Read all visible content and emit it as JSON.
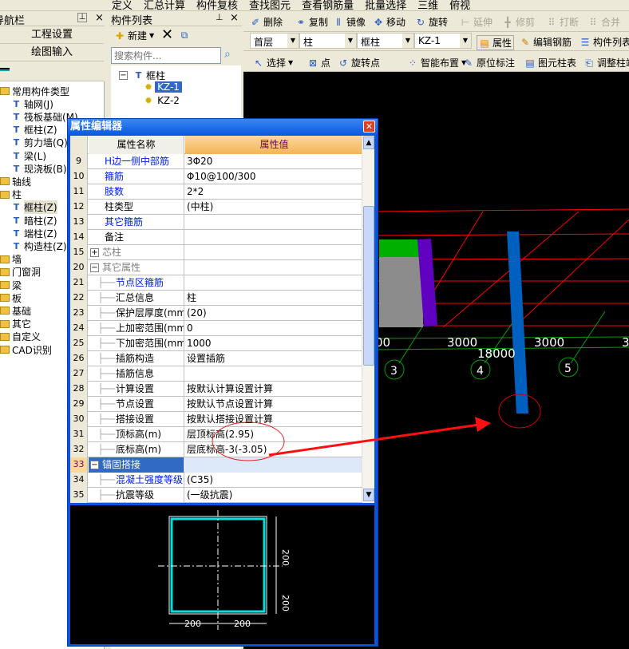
{
  "top_toolbar": {
    "items": [
      "定义",
      "汇总计算",
      "构件复核",
      "查找图元",
      "查看钢筋量",
      "批量选择",
      "三维",
      "俯视"
    ]
  },
  "nav_panel": {
    "title": "导航栏",
    "buttons": [
      "工程设置",
      "绘图输入"
    ],
    "tree": [
      {
        "label": "常用构件类型",
        "type": "folder-open",
        "level": 0
      },
      {
        "label": "轴网(J)",
        "icon": "grid-icon",
        "level": 1
      },
      {
        "label": "筏板基础(M)",
        "icon": "raft-icon",
        "level": 1
      },
      {
        "label": "框柱(Z)",
        "icon": "column-icon",
        "level": 1
      },
      {
        "label": "剪力墙(Q)",
        "icon": "wall-icon",
        "level": 1
      },
      {
        "label": "梁(L)",
        "icon": "beam-icon",
        "level": 1
      },
      {
        "label": "现浇板(B)",
        "icon": "slab-icon",
        "level": 1
      },
      {
        "label": "轴线",
        "type": "folder",
        "level": 0
      },
      {
        "label": "柱",
        "type": "folder-open",
        "level": 0
      },
      {
        "label": "框柱(Z)",
        "icon": "column-icon",
        "level": 1,
        "selected": true
      },
      {
        "label": "暗柱(Z)",
        "icon": "column-icon",
        "level": 1
      },
      {
        "label": "端柱(Z)",
        "icon": "column-icon",
        "level": 1
      },
      {
        "label": "构造柱(Z)",
        "icon": "constructional-column-icon",
        "level": 1
      },
      {
        "label": "墙",
        "type": "folder",
        "level": 0
      },
      {
        "label": "门窗洞",
        "type": "folder",
        "level": 0
      },
      {
        "label": "梁",
        "type": "folder",
        "level": 0
      },
      {
        "label": "板",
        "type": "folder",
        "level": 0
      },
      {
        "label": "基础",
        "type": "folder",
        "level": 0
      },
      {
        "label": "其它",
        "type": "folder",
        "level": 0
      },
      {
        "label": "自定义",
        "type": "folder",
        "level": 0
      },
      {
        "label": "CAD识别",
        "type": "folder",
        "level": 0
      }
    ]
  },
  "component_list": {
    "title": "构件列表",
    "new_label": "新建",
    "search_placeholder": "搜索构件...",
    "root": "框柱",
    "items": [
      {
        "label": "KZ-1",
        "selected": true
      },
      {
        "label": "KZ-2"
      }
    ]
  },
  "edit_toolbar": {
    "items": [
      {
        "label": "删除"
      },
      {
        "label": "复制"
      },
      {
        "label": "镜像"
      },
      {
        "label": "移动"
      },
      {
        "label": "旋转"
      },
      {
        "label": "延伸",
        "disabled": true
      },
      {
        "label": "修剪",
        "disabled": true
      },
      {
        "label": "打断",
        "disabled": true
      },
      {
        "label": "合并",
        "disabled": true
      }
    ]
  },
  "selectors": {
    "floor": "首层",
    "type": "柱",
    "subtype": "框柱",
    "component": "KZ-1",
    "buttons": [
      "属性",
      "编辑钢筋",
      "构件列表"
    ]
  },
  "draw_toolbar": {
    "items": [
      "选择",
      "点",
      "旋转点",
      "智能布置",
      "原位标注",
      "图元柱表",
      "调整柱端"
    ]
  },
  "canvas": {
    "dimensions": [
      "00",
      "3000",
      "3000",
      "3",
      "18000"
    ],
    "axis_labels": [
      "3",
      "4",
      "5"
    ],
    "colors": {
      "grid": "#ff0000",
      "axis": "#00a000",
      "column": "#0060c0",
      "wall": "#6000c0"
    }
  },
  "property_editor": {
    "title": "属性编辑器",
    "col_name": "属性名称",
    "col_value": "属性值",
    "rows": [
      {
        "n": "9",
        "name": "H边一侧中部筋",
        "value": "3Φ20",
        "style": "blue"
      },
      {
        "n": "10",
        "name": "箍筋",
        "value": "Φ10@100/300",
        "style": "blue"
      },
      {
        "n": "11",
        "name": "肢数",
        "value": "2*2",
        "style": "blue"
      },
      {
        "n": "12",
        "name": "柱类型",
        "value": "(中柱)"
      },
      {
        "n": "13",
        "name": "其它箍筋",
        "value": "",
        "style": "blue"
      },
      {
        "n": "14",
        "name": "备注",
        "value": ""
      },
      {
        "n": "15",
        "name": "芯柱",
        "value": "",
        "style": "gray",
        "expander": "+"
      },
      {
        "n": "20",
        "name": "其它属性",
        "value": "",
        "style": "gray",
        "expander": "−"
      },
      {
        "n": "21",
        "name": "节点区箍筋",
        "value": "",
        "style": "blue",
        "child": true
      },
      {
        "n": "22",
        "name": "汇总信息",
        "value": "柱",
        "child": true
      },
      {
        "n": "23",
        "name": "保护层厚度(mm)",
        "value": "(20)",
        "child": true
      },
      {
        "n": "24",
        "name": "上加密范围(mm)",
        "value": "0",
        "child": true
      },
      {
        "n": "25",
        "name": "下加密范围(mm)",
        "value": "1000",
        "child": true
      },
      {
        "n": "26",
        "name": "插筋构造",
        "value": "设置插筋",
        "child": true
      },
      {
        "n": "27",
        "name": "插筋信息",
        "value": "",
        "child": true
      },
      {
        "n": "28",
        "name": "计算设置",
        "value": "按默认计算设置计算",
        "child": true
      },
      {
        "n": "29",
        "name": "节点设置",
        "value": "按默认节点设置计算",
        "child": true
      },
      {
        "n": "30",
        "name": "搭接设置",
        "value": "按默认搭接设置计算",
        "child": true
      },
      {
        "n": "31",
        "name": "顶标高(m)",
        "value": "层顶标高(2.95)",
        "child": true
      },
      {
        "n": "32",
        "name": "底标高(m)",
        "value": "层底标高-3(-3.05)",
        "child": true
      },
      {
        "n": "33",
        "name": "锚固搭接",
        "value": "",
        "expander": "−",
        "selected": true
      },
      {
        "n": "34",
        "name": "混凝土强度等级",
        "value": "(C35)",
        "style": "blue",
        "child": true
      },
      {
        "n": "35",
        "name": "抗震等级",
        "value": "(一级抗震)",
        "child": true
      }
    ],
    "section_dims": {
      "b": [
        "200",
        "200"
      ],
      "h": [
        "200",
        "200"
      ]
    }
  }
}
